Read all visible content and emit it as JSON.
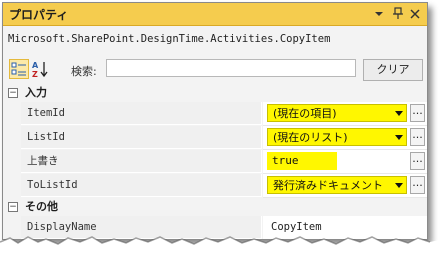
{
  "window": {
    "title": "プロパティ",
    "buttons": {
      "dropdown": "▾",
      "pin": "ᛘ",
      "close": "×"
    }
  },
  "object_name": "Microsoft.SharePoint.DesignTime.Activities.CopyItem",
  "toolbar": {
    "search_label": "検索:",
    "search_value": "",
    "clear_label": "クリア",
    "sort_categorized_icon": "categorized-icon",
    "sort_alpha_icon": "alpha-sort-icon"
  },
  "grid": {
    "categories": [
      {
        "label": "入力",
        "toggle": "⊟",
        "rows": [
          {
            "name": "ItemId",
            "value": "(現在の項目)",
            "type": "dropdown"
          },
          {
            "name": "ListId",
            "value": "(現在のリスト)",
            "type": "dropdown"
          },
          {
            "name": "上書き",
            "value": "true",
            "type": "text"
          },
          {
            "name": "ToListId",
            "value": "発行済みドキュメント",
            "type": "dropdown"
          }
        ]
      },
      {
        "label": "その他",
        "toggle": "⊟",
        "rows": [
          {
            "name": "DisplayName",
            "value": "CopyItem",
            "type": "text"
          }
        ]
      }
    ],
    "ellipsis_label": "..."
  },
  "colors": {
    "titlebar": "#f5cc4e",
    "highlight": "#fff700"
  }
}
